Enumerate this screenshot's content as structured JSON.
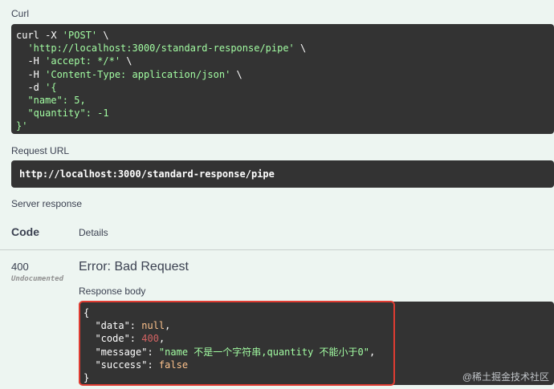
{
  "curl_section": {
    "title": "Curl",
    "lines": [
      [
        {
          "t": "curl -X ",
          "c": "w"
        },
        {
          "t": "'POST'",
          "c": "str"
        },
        {
          "t": " \\",
          "c": "w"
        }
      ],
      [
        {
          "t": "  ",
          "c": "w"
        },
        {
          "t": "'http://localhost:3000/standard-response/pipe'",
          "c": "str"
        },
        {
          "t": " \\",
          "c": "w"
        }
      ],
      [
        {
          "t": "  -H ",
          "c": "w"
        },
        {
          "t": "'accept: */*'",
          "c": "str"
        },
        {
          "t": " \\",
          "c": "w"
        }
      ],
      [
        {
          "t": "  -H ",
          "c": "w"
        },
        {
          "t": "'Content-Type: application/json'",
          "c": "str"
        },
        {
          "t": " \\",
          "c": "w"
        }
      ],
      [
        {
          "t": "  -d ",
          "c": "w"
        },
        {
          "t": "'{",
          "c": "str"
        }
      ],
      [
        {
          "t": "  \"name\": 5,",
          "c": "str"
        }
      ],
      [
        {
          "t": "  \"quantity\": -1",
          "c": "str"
        }
      ],
      [
        {
          "t": "}'",
          "c": "str"
        }
      ]
    ]
  },
  "request_url": {
    "title": "Request URL",
    "value": "http://localhost:3000/standard-response/pipe"
  },
  "server_response": {
    "title": "Server response",
    "col_code": "Code",
    "col_details": "Details",
    "code": "400",
    "code_note": "Undocumented",
    "error_title": "Error: Bad Request",
    "body_label": "Response body",
    "body_lines": [
      [
        {
          "t": "{",
          "c": "w"
        }
      ],
      [
        {
          "t": "  \"data\": ",
          "c": "key"
        },
        {
          "t": "null",
          "c": "nul"
        },
        {
          "t": ",",
          "c": "w"
        }
      ],
      [
        {
          "t": "  \"code\": ",
          "c": "key"
        },
        {
          "t": "400",
          "c": "num"
        },
        {
          "t": ",",
          "c": "w"
        }
      ],
      [
        {
          "t": "  \"message\": ",
          "c": "key"
        },
        {
          "t": "\"name 不是一个字符串,quantity 不能小于0\"",
          "c": "str"
        },
        {
          "t": ",",
          "c": "w"
        }
      ],
      [
        {
          "t": "  \"success\": ",
          "c": "key"
        },
        {
          "t": "false",
          "c": "bool"
        }
      ],
      [
        {
          "t": "}",
          "c": "w"
        }
      ]
    ]
  },
  "watermark": "@稀土掘金技术社区",
  "colors": {
    "background": "#edf5f1",
    "code_bg": "#333333",
    "string": "#a2fca2",
    "highlight_border": "#e03c32"
  }
}
